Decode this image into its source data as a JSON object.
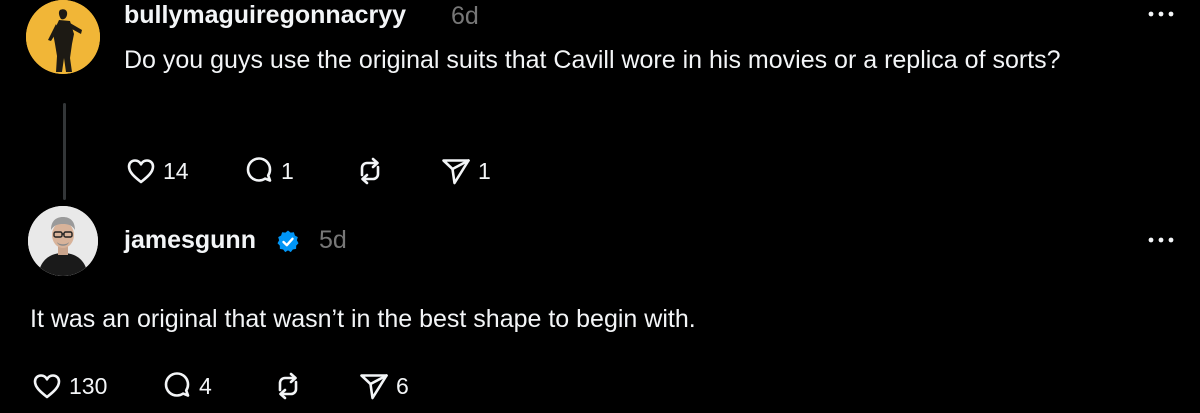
{
  "replies": [
    {
      "username": "bullymaguiregonnacryy",
      "timestamp": "6d",
      "text": "Do you guys use the original suits that Cavill wore in his movies or a replica of sorts?",
      "likes": "14",
      "comments": "1",
      "reposts": "",
      "shares": "1",
      "avatar_color": "#f1b637",
      "verified": false
    },
    {
      "username": "jamesgunn",
      "timestamp": "5d",
      "text": "It was an original that wasn’t in the best shape to begin with.",
      "likes": "130",
      "comments": "4",
      "reposts": "",
      "shares": "6",
      "avatar_color": "#e9e9e9",
      "verified": true
    }
  ],
  "icons": {
    "like": "heart-icon",
    "comment": "speech-bubble-icon",
    "repost": "repost-icon",
    "share": "send-icon",
    "more": "more-dots-icon",
    "verified": "verified-badge-icon"
  },
  "colors": {
    "background": "#000000",
    "text": "#f3f5f7",
    "muted": "#777777",
    "verified": "#0095f6",
    "thread_line": "#333638"
  }
}
